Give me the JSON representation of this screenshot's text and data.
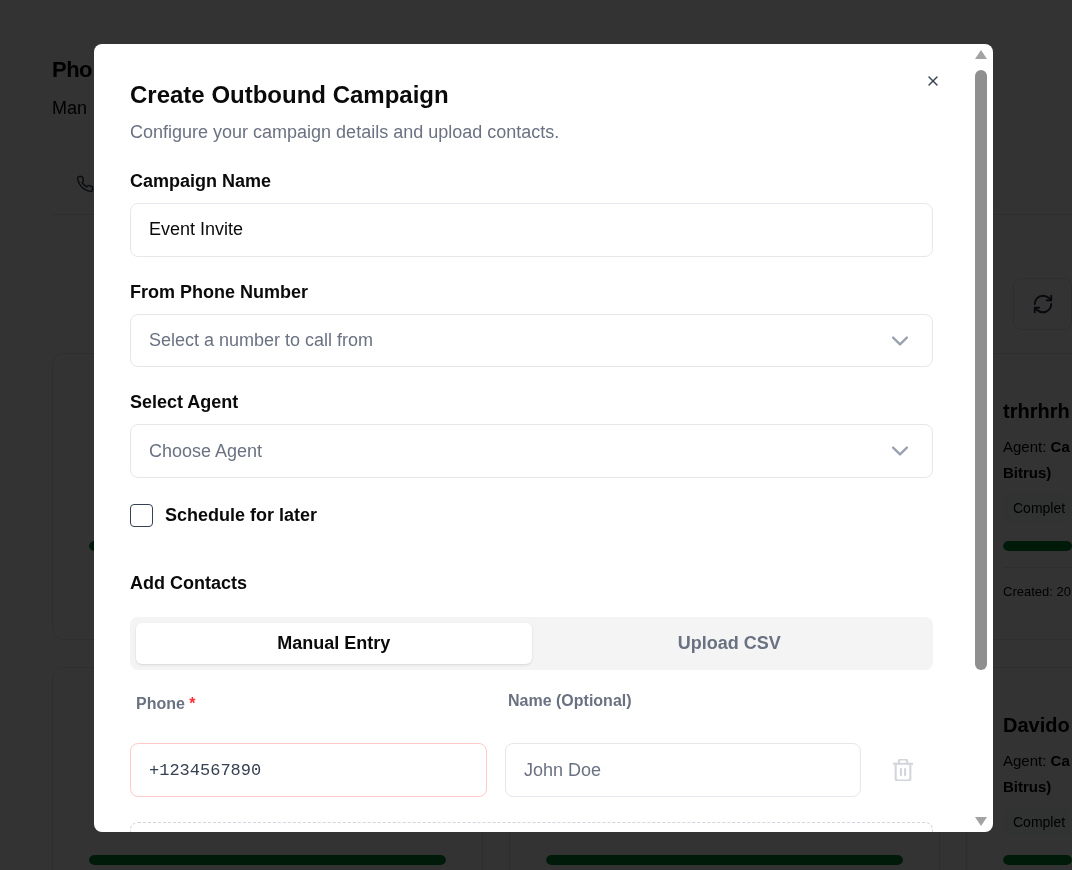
{
  "page": {
    "title": "Pho",
    "subtitle": "Man"
  },
  "campaign_rows": [
    {
      "cards": [
        {
          "level": 1
        },
        {
          "title": "trhrhrh",
          "agent": "Agent: **Ca**",
          "agent_more": "Bitrus)",
          "status": "Complet",
          "level": 1,
          "created": "Created: 20"
        }
      ]
    },
    {
      "cards": [
        {
          "level": 1
        },
        {
          "level": 1
        },
        {
          "title": "Davido",
          "agent": "Agent: **Ca**",
          "agent_more": "Bitrus)",
          "status": "Complet",
          "level": 1
        }
      ]
    }
  ],
  "dialog": {
    "title": "Create Outbound Campaign",
    "description": "Configure your campaign details and upload contacts.",
    "fields": [
      {
        "kind": "text",
        "label": "Campaign Name",
        "value": "Event Invite"
      },
      {
        "kind": "select",
        "label": "From Phone Number",
        "placeholder": "Select a number to call from"
      },
      {
        "kind": "select",
        "label": "Select Agent",
        "placeholder": "Choose Agent"
      }
    ],
    "schedule": {
      "label": "Schedule for later",
      "checked": false
    },
    "contacts": {
      "heading": "Add Contacts",
      "tabs": [
        {
          "label": "Manual Entry",
          "selected": true
        },
        {
          "label": "Upload CSV",
          "selected": false
        }
      ],
      "columns": [
        {
          "label": "Phone",
          "required_mark": "*"
        },
        {
          "label": "Name (Optional)"
        }
      ],
      "rows": [
        {
          "phone": {
            "value": "+1234567890",
            "invalid": true
          },
          "name": {
            "placeholder": "John Doe"
          }
        }
      ]
    }
  }
}
